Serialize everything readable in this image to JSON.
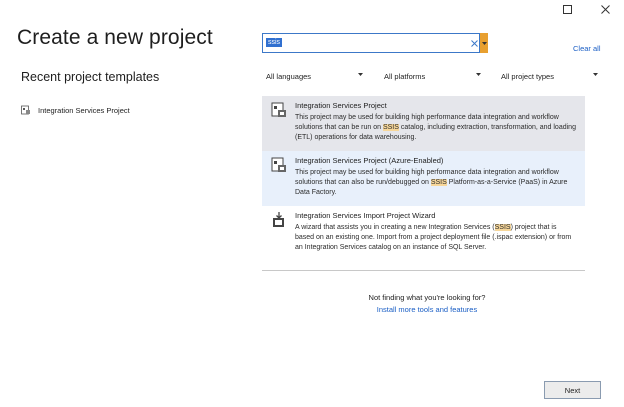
{
  "window": {
    "maximize_icon": "maximize-icon",
    "close_icon": "close-icon"
  },
  "title": "Create a new project",
  "recent": {
    "heading": "Recent project templates",
    "items": [
      {
        "label": "Integration Services Project",
        "icon": "ssis-project-icon"
      }
    ]
  },
  "search": {
    "value": "ssis",
    "clear_icon": "clear-icon",
    "dropdown_icon": "chevron-down-icon"
  },
  "clear_all_label": "Clear all",
  "filters": {
    "languages": "All languages",
    "platforms": "All platforms",
    "project_types": "All project types"
  },
  "results": [
    {
      "title": "Integration Services Project",
      "desc_before": "This project may be used for building high performance data integration and workflow solutions that can be run on ",
      "highlight": "SSIS",
      "desc_after": " catalog, including extraction, transformation, and loading (ETL) operations for data warehousing.",
      "state": "selected"
    },
    {
      "title": "Integration Services Project (Azure-Enabled)",
      "desc_before": "This project may be used for building high performance data integration and workflow solutions that can also be run/debugged on ",
      "highlight": "SSIS",
      "desc_after": " Platform-as-a-Service (PaaS) in Azure Data Factory.",
      "state": "hover"
    },
    {
      "title": "Integration Services Import Project Wizard",
      "desc_before": "A wizard that assists you in creating a new Integration Services (",
      "highlight": "SSIS",
      "desc_after": ") project that is based on an existing one. Import from a project deployment file (.ispac extension) or from an Integration Services catalog on an instance of SQL Server.",
      "state": "normal"
    }
  ],
  "not_found": {
    "question": "Not finding what you're looking for?",
    "link": "Install more tools and features"
  },
  "next_label": "Next",
  "colors": {
    "accent": "#3c78c8",
    "link": "#1a5ec5",
    "highlight": "#f7d79a",
    "selected_bg": "#e5e6eb",
    "hover_bg": "#e8f0fb"
  }
}
